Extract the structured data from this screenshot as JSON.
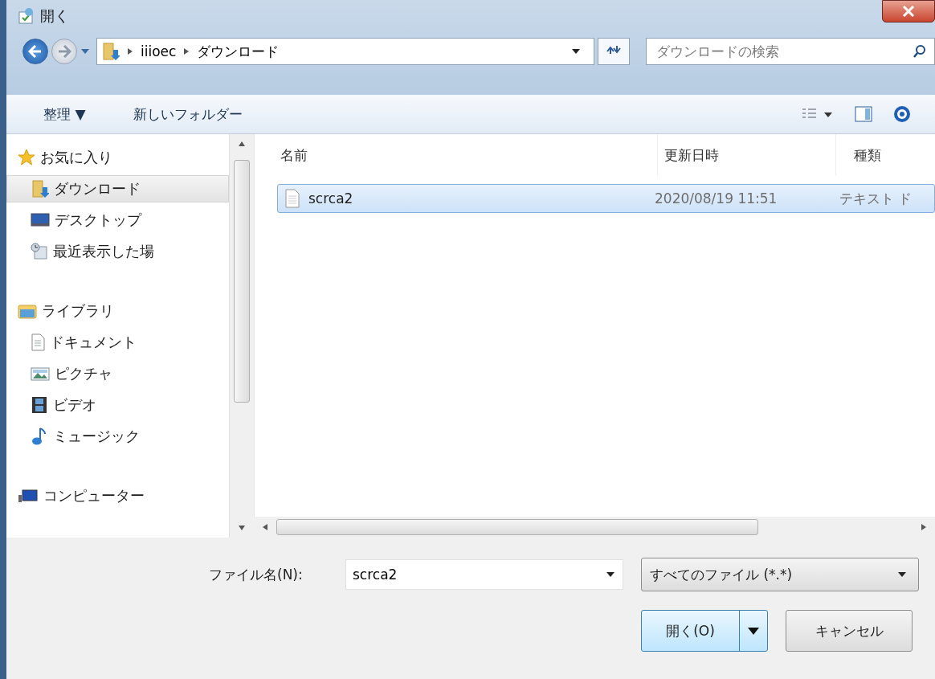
{
  "window": {
    "title": "開く"
  },
  "address_bar": {
    "path": [
      "iiioec",
      "ダウンロード"
    ]
  },
  "search": {
    "placeholder": "ダウンロードの検索"
  },
  "toolbar": {
    "organize": "整理 ▼",
    "new_folder": "新しいフォルダー"
  },
  "sidebar": {
    "groups": [
      {
        "label": "お気に入り",
        "children": [
          {
            "label": "ダウンロード",
            "selected": true
          },
          {
            "label": "デスクトップ",
            "selected": false
          },
          {
            "label": "最近表示した場",
            "selected": false
          }
        ]
      },
      {
        "label": "ライブラリ",
        "children": [
          {
            "label": "ドキュメント",
            "selected": false
          },
          {
            "label": "ピクチャ",
            "selected": false
          },
          {
            "label": "ビデオ",
            "selected": false
          },
          {
            "label": "ミュージック",
            "selected": false
          }
        ]
      },
      {
        "label": "コンピューター"
      }
    ]
  },
  "file_list": {
    "columns": [
      "名前",
      "更新日時",
      "種類"
    ],
    "rows": [
      {
        "name": "scrca2",
        "modified": "2020/08/19 11:51",
        "type": "テキスト ド",
        "selected": true
      }
    ]
  },
  "file_name": {
    "label": "ファイル名(N):",
    "value": "scrca2"
  },
  "file_type": {
    "value": "すべてのファイル (*.*)"
  },
  "buttons": {
    "open": "開く(O)",
    "cancel": "キャンセル"
  }
}
